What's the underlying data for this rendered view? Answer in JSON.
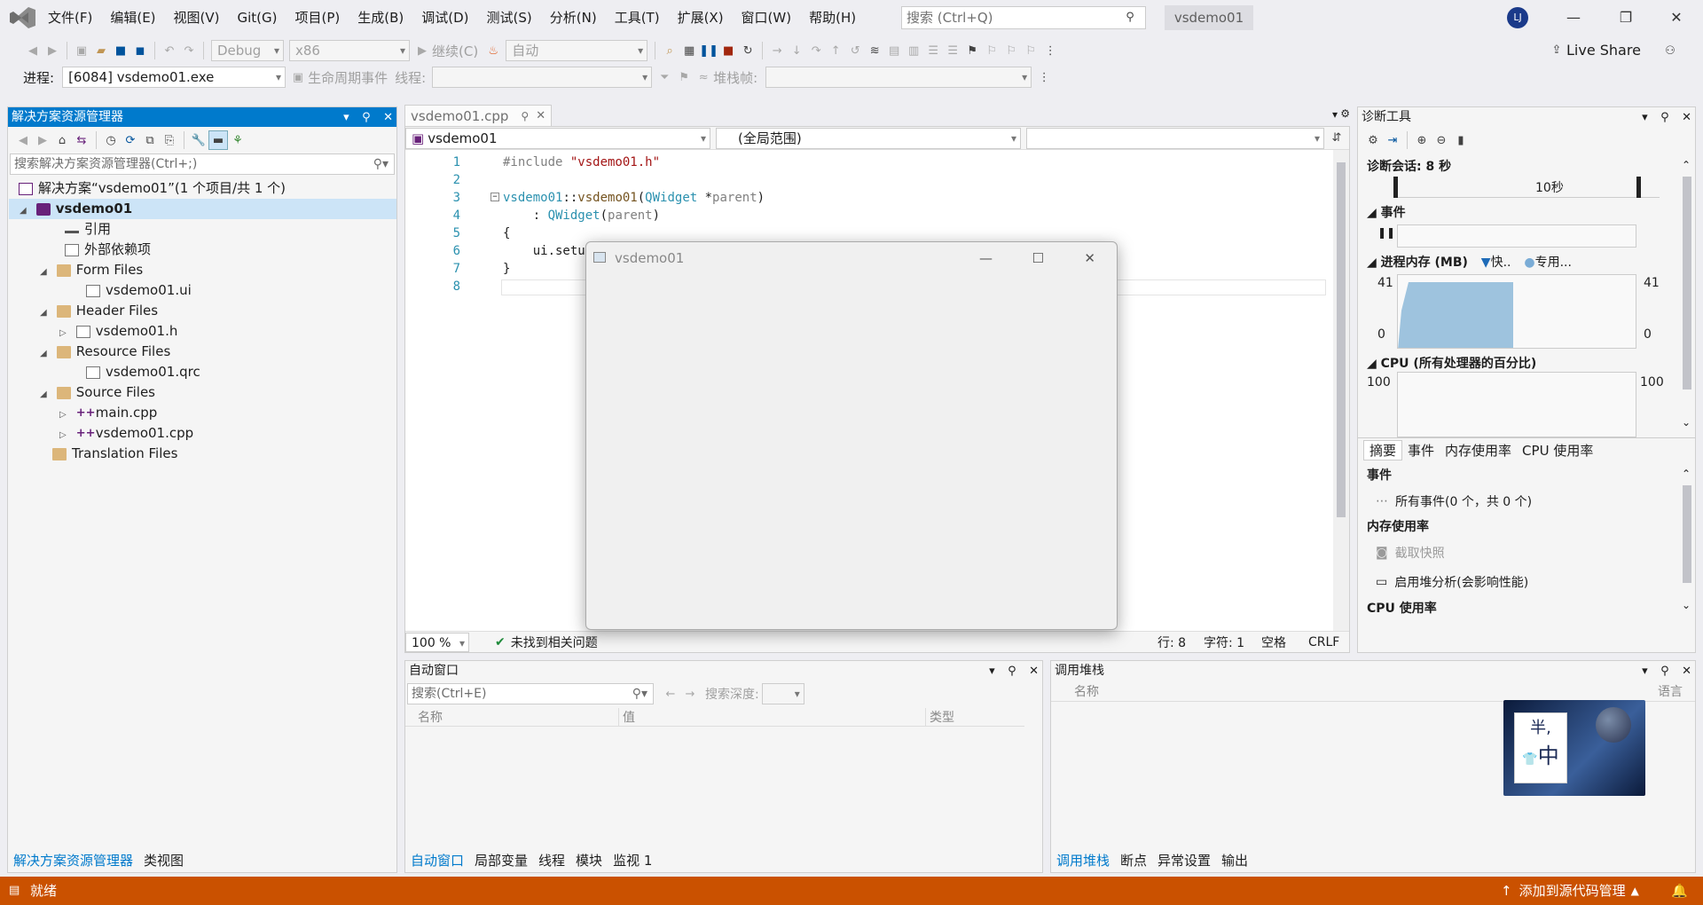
{
  "menu": [
    "文件(F)",
    "编辑(E)",
    "视图(V)",
    "Git(G)",
    "项目(P)",
    "生成(B)",
    "调试(D)",
    "测试(S)",
    "分析(N)",
    "工具(T)",
    "扩展(X)",
    "窗口(W)",
    "帮助(H)"
  ],
  "search": {
    "placeholder": "搜索 (Ctrl+Q)"
  },
  "solution_badge": "vsdemo01",
  "avatar": "LJ",
  "toolbar": {
    "config": "Debug",
    "platform": "x86",
    "continue": "继续(C)",
    "auto": "自动",
    "live_share": "Live Share"
  },
  "toolbar2": {
    "process_label": "进程:",
    "process_value": "[6084] vsdemo01.exe",
    "lifecycle": "生命周期事件",
    "thread_label": "线程:",
    "stackframe_label": "堆栈帧:"
  },
  "solution_explorer": {
    "title": "解决方案资源管理器",
    "search_placeholder": "搜索解决方案资源管理器(Ctrl+;)",
    "solution": "解决方案“vsdemo01”(1 个项目/共 1 个)",
    "project": "vsdemo01",
    "references": "引用",
    "external": "外部依赖项",
    "form_files": "Form Files",
    "ui_file": "vsdemo01.ui",
    "header_files": "Header Files",
    "h_file": "vsdemo01.h",
    "resource_files": "Resource Files",
    "qrc_file": "vsdemo01.qrc",
    "source_files": "Source Files",
    "main_cpp": "main.cpp",
    "vs_cpp": "vsdemo01.cpp",
    "translation_files": "Translation Files",
    "tab1": "解决方案资源管理器",
    "tab2": "类视图"
  },
  "editor": {
    "tab": "vsdemo01.cpp",
    "nav1": "vsdemo01",
    "nav2": "(全局范围)",
    "zoom": "100 %",
    "issues": "未找到相关问题",
    "row": "行: 8",
    "col": "字符: 1",
    "space": "空格",
    "eol": "CRLF",
    "ln": [
      "1",
      "2",
      "3",
      "4",
      "5",
      "6",
      "7",
      "8"
    ],
    "line1_pp": "#include ",
    "line1_str": "\"vsdemo01.h\"",
    "line3_cls": "vsdemo01",
    "line3_sep": "::",
    "line3_fn": "vsdemo01",
    "line3_open": "(",
    "line3_type": "QWidget",
    "line3_star": " *",
    "line3_param": "parent",
    "line3_close": ")",
    "line4_colon": "    : ",
    "line4_type": "QWidget",
    "line4_open": "(",
    "line4_param": "parent",
    "line4_close": ")",
    "line5": "{",
    "line6": "    ui.setup",
    "line7": "}"
  },
  "qt_window": {
    "title": "vsdemo01"
  },
  "diagnostics": {
    "title": "诊断工具",
    "session": "诊断会话: 8 秒",
    "time_tick": "10秒",
    "events": "事件",
    "memory": "进程内存 (MB)",
    "legend_fast": "快..",
    "legend_private": "专用...",
    "mem_max": "41",
    "mem_min": "0",
    "cpu": "CPU (所有处理器的百分比)",
    "cpu_max": "100",
    "tabs": [
      "摘要",
      "事件",
      "内存使用率",
      "CPU 使用率"
    ],
    "events_header": "事件",
    "all_events": "所有事件(0 个，共 0 个)",
    "mem_header": "内存使用率",
    "snapshot": "截取快照",
    "heap": "启用堆分析(会影响性能)",
    "cpu_header": "CPU 使用率"
  },
  "autos": {
    "title": "自动窗口",
    "search_placeholder": "搜索(Ctrl+E)",
    "depth": "搜索深度:",
    "cols": [
      "名称",
      "值",
      "类型"
    ],
    "tabs": [
      "自动窗口",
      "局部变量",
      "线程",
      "模块",
      "监视 1"
    ]
  },
  "callstack": {
    "title": "调用堆栈",
    "cols": [
      "名称",
      "语言"
    ],
    "tabs": [
      "调用堆栈",
      "断点",
      "异常设置",
      "输出"
    ],
    "ime1": "半,",
    "ime2": "中"
  },
  "status": {
    "ready": "就绪",
    "scm": "添加到源代码管理"
  },
  "colors": {
    "accent": "#007acc",
    "status_bar": "#ca5100"
  }
}
